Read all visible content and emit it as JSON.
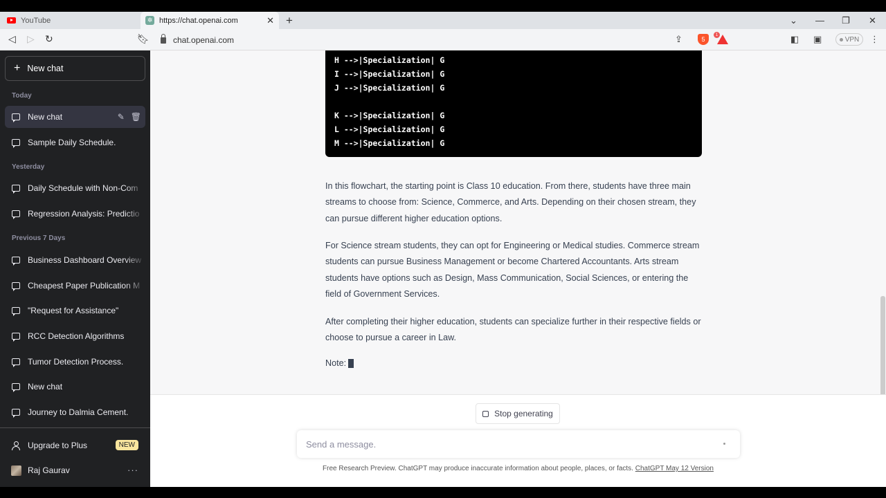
{
  "browser": {
    "tabs": [
      {
        "title": "YouTube"
      },
      {
        "title": "https://chat.openai.com"
      }
    ],
    "new_tab_icon": "+",
    "tab_close_icon": "✕",
    "window_controls": {
      "dropdown": "⌄",
      "minimize": "—",
      "restore": "❐",
      "close": "✕"
    },
    "url": "chat.openai.com",
    "vpn_label": "VPN",
    "shields_count": "5",
    "rewards_count": "1"
  },
  "sidebar": {
    "new_chat_label": "New chat",
    "sections": {
      "today": "Today",
      "yesterday": "Yesterday",
      "previous": "Previous 7 Days"
    },
    "today_items": [
      "New chat",
      "Sample Daily Schedule."
    ],
    "yesterday_items": [
      "Daily Schedule with Non-Com",
      "Regression Analysis: Predictio"
    ],
    "previous_items": [
      "Business Dashboard Overview",
      "Cheapest Paper Publication M",
      "\"Request for Assistance\"",
      "RCC Detection Algorithms",
      "Tumor Detection Process.",
      "New chat",
      "Journey to Dalmia Cement."
    ],
    "upgrade_label": "Upgrade to Plus",
    "new_badge": "NEW",
    "user_name": "Raj Gaurav",
    "more_icon": "···"
  },
  "conversation": {
    "code_lines": [
      "H -->|Specialization| G",
      "I -->|Specialization| G",
      "J -->|Specialization| G",
      "",
      "K -->|Specialization| G",
      "L -->|Specialization| G",
      "M -->|Specialization| G"
    ],
    "paragraphs": [
      "In this flowchart, the starting point is Class 10 education. From there, students have three main streams to choose from: Science, Commerce, and Arts. Depending on their chosen stream, they can pursue different higher education options.",
      "For Science stream students, they can opt for Engineering or Medical studies. Commerce stream students can pursue Business Management or become Chartered Accountants. Arts stream students have options such as Design, Mass Communication, Social Sciences, or entering the field of Government Services.",
      "After completing their higher education, students can specialize further in their respective fields or choose to pursue a career in Law."
    ],
    "note_label": "Note:"
  },
  "composer": {
    "stop_label": "Stop generating",
    "placeholder": "Send a message.",
    "disclaimer_text": "Free Research Preview. ChatGPT may produce inaccurate information about people, places, or facts. ",
    "version_link": "ChatGPT May 12 Version"
  }
}
